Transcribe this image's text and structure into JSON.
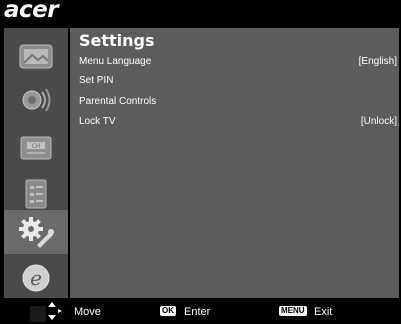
{
  "brand": {
    "logo_text": "acer"
  },
  "sidebar": {
    "items": [
      {
        "icon": "picture-icon"
      },
      {
        "icon": "sound-icon"
      },
      {
        "icon": "channel-icon"
      },
      {
        "icon": "checklist-icon"
      },
      {
        "icon": "gear-icon",
        "active": true
      },
      {
        "icon": "e-icon"
      }
    ]
  },
  "settings": {
    "title": "Settings",
    "rows": [
      {
        "label": "Menu Language",
        "value": "[English]"
      },
      {
        "label": "Set PIN",
        "value": ""
      },
      {
        "label": "Parental Controls",
        "value": ""
      },
      {
        "label": "Lock TV",
        "value": "[Unlock]"
      }
    ]
  },
  "footer": {
    "move_label": "Move",
    "ok_badge": "OK",
    "enter_label": "Enter",
    "menu_badge": "MENU",
    "exit_label": "Exit"
  }
}
